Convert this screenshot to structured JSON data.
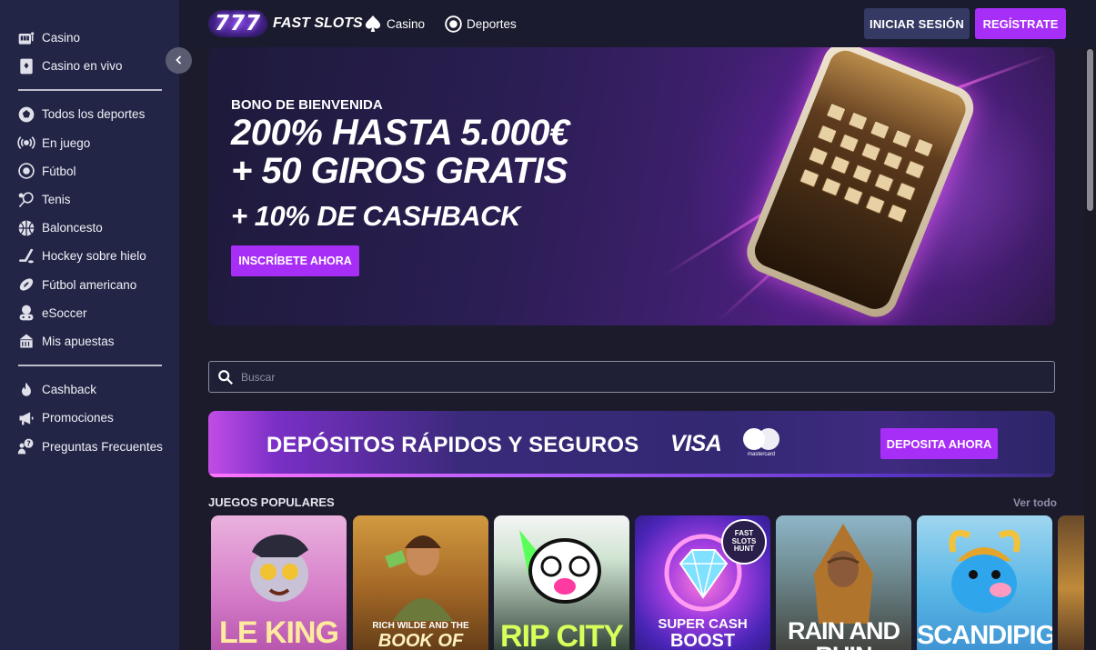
{
  "sidebar": {
    "collapse_icon": "chevron-left-icon",
    "group1": [
      {
        "label": "Casino",
        "icon": "slot-machine-icon"
      },
      {
        "label": "Casino en vivo",
        "icon": "card-icon"
      }
    ],
    "group2": [
      {
        "label": "Todos los deportes",
        "icon": "sports-icon"
      },
      {
        "label": "En juego",
        "icon": "live-icon"
      },
      {
        "label": "Fútbol",
        "icon": "soccer-ball-icon"
      },
      {
        "label": "Tenis",
        "icon": "tennis-icon"
      },
      {
        "label": "Baloncesto",
        "icon": "basketball-icon"
      },
      {
        "label": "Hockey sobre hielo",
        "icon": "hockey-icon"
      },
      {
        "label": "Fútbol americano",
        "icon": "american-football-icon"
      },
      {
        "label": "eSoccer",
        "icon": "esoccer-icon"
      },
      {
        "label": "Mis apuestas",
        "icon": "bets-icon"
      }
    ],
    "group3": [
      {
        "label": "Cashback",
        "icon": "flame-icon"
      },
      {
        "label": "Promociones",
        "icon": "megaphone-icon"
      },
      {
        "label": "Preguntas Frecuentes",
        "icon": "faq-icon"
      }
    ]
  },
  "header": {
    "logo_sevens": "777",
    "logo_text": "FAST SLOTS",
    "nav": [
      {
        "label": "Casino",
        "icon": "spade-icon"
      },
      {
        "label": "Deportes",
        "icon": "soccer-ball-icon"
      }
    ],
    "login_label": "INICIAR SESIÓN",
    "register_label": "REGÍSTRATE"
  },
  "hero": {
    "kicker": "BONO DE BIENVENIDA",
    "line1": "200% HASTA 5.000€",
    "line2": "+ 50 GIROS GRATIS",
    "line3": "+ 10% DE CASHBACK",
    "cta": "INSCRÍBETE AHORA"
  },
  "search": {
    "placeholder": "Buscar"
  },
  "deposit": {
    "title": "DEPÓSITOS RÁPIDOS Y SEGUROS",
    "visa": "VISA",
    "mastercard": "mastercard",
    "cta": "DEPOSITA AHORA"
  },
  "games": {
    "title": "JUEGOS POPULARES",
    "see_all": "Ver todo",
    "items": [
      {
        "name": "LE KING",
        "colors": [
          "#e7a2d8",
          "#c25fb9"
        ]
      },
      {
        "name": "RICH WILDE AND THE",
        "name2": "BOOK OF DEAD",
        "colors": [
          "#d69a3c",
          "#6e4417"
        ]
      },
      {
        "name": "RIP CITY",
        "colors": [
          "#cfe8d2",
          "#1b2b1e"
        ]
      },
      {
        "name": "SUPER CASH",
        "name2": "BOOST",
        "badge": "FAST SLOTS HUNT",
        "colors": [
          "#5a2fd0",
          "#b447e6"
        ]
      },
      {
        "name": "RAIN AND RUIN",
        "colors": [
          "#7da3b8",
          "#3b3a34"
        ]
      },
      {
        "name": "SCANDIPIGS",
        "colors": [
          "#56c0f0",
          "#2a86c9"
        ]
      }
    ]
  }
}
